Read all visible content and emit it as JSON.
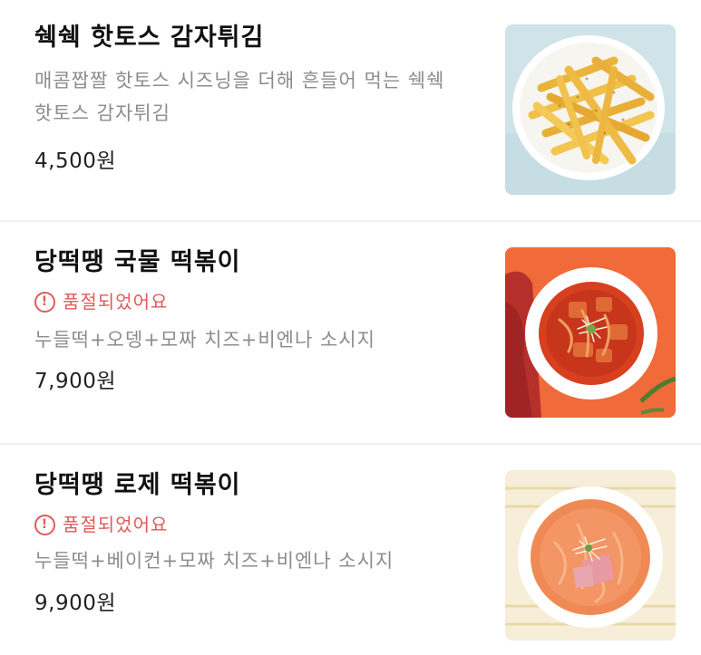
{
  "menu": {
    "items": [
      {
        "name": "쉑쉑 핫토스 감자튀김",
        "desc_line1": "매콤짭짤 핫토스 시즈닝을 더해 흔들어 먹는 쉑쉑",
        "desc_line2": "핫토스 감자튀김",
        "price": "4,500원",
        "sold_out": false,
        "image": "french-fries-plate"
      },
      {
        "name": "당떡땡 국물 떡볶이",
        "status": "품절되었어요",
        "desc": "누들떡+오뎅+모짜 치즈+비엔나 소시지",
        "price": "7,900원",
        "sold_out": true,
        "image": "soup-tteokbokki-bowl"
      },
      {
        "name": "당떡땡 로제 떡볶이",
        "status": "품절되었어요",
        "desc": "누들떡+베이컨+모짜 치즈+비엔나 소시지",
        "price": "9,900원",
        "sold_out": true,
        "image": "rose-tteokbokki-bowl"
      }
    ],
    "soldout_icon_glyph": "!",
    "colors": {
      "soldout": "#e05a5a",
      "description": "#8c8c8c",
      "divider": "#f1f1f1"
    }
  }
}
